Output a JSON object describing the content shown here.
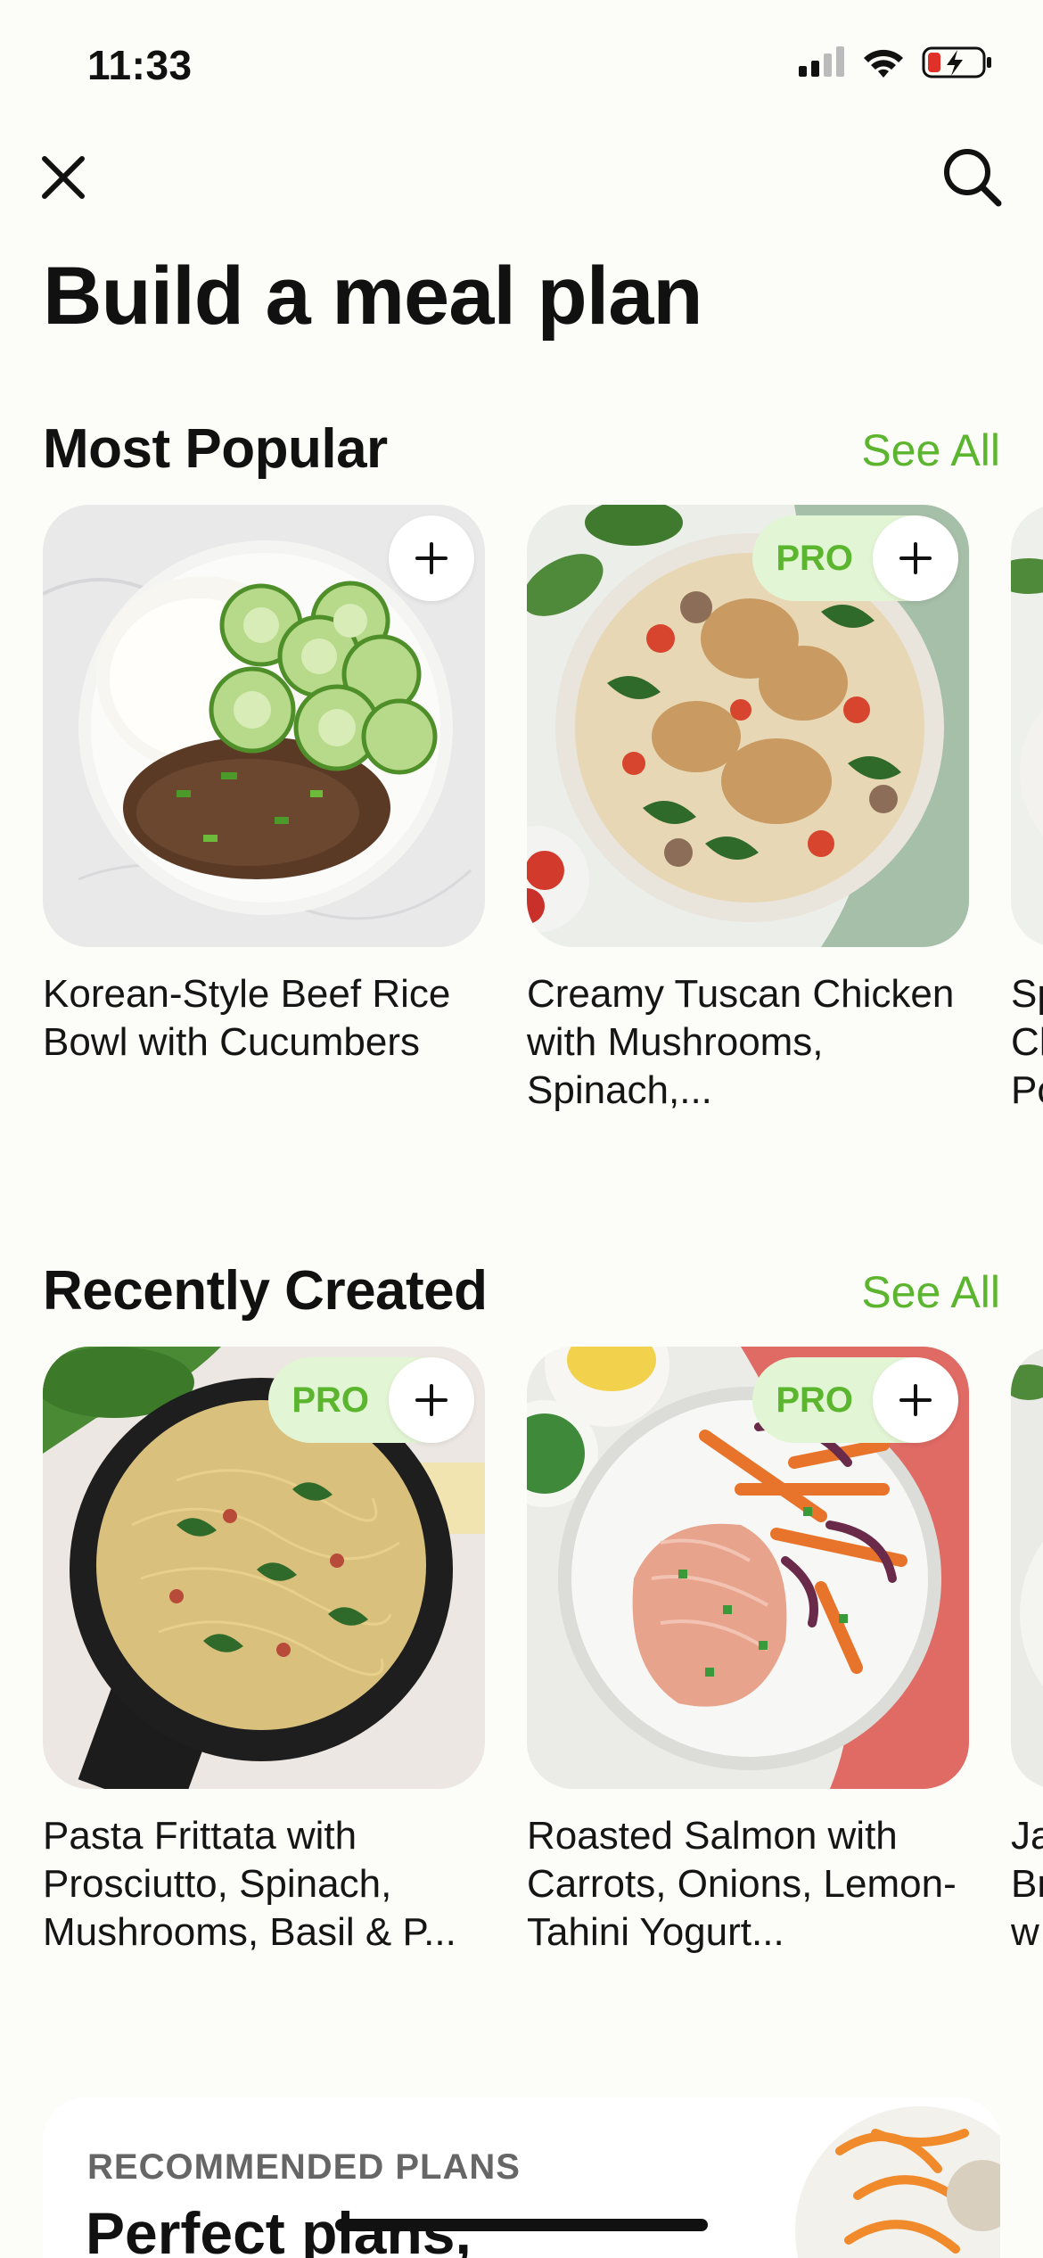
{
  "status": {
    "time": "11:33"
  },
  "nav": {
    "close_icon": "close-icon",
    "search_icon": "search-icon"
  },
  "page": {
    "title": "Build a meal plan"
  },
  "sections": [
    {
      "title": "Most Popular",
      "see_all": "See All",
      "cards": [
        {
          "title": "Korean-Style Beef Rice Bowl with Cucumbers",
          "pro": false
        },
        {
          "title": "Creamy Tuscan Chicken with Mushrooms, Spinach,...",
          "pro": true,
          "pro_label": "PRO"
        },
        {
          "title": "Sp Ch Po",
          "pro": false
        }
      ]
    },
    {
      "title": "Recently Created",
      "see_all": "See All",
      "cards": [
        {
          "title": "Pasta Frittata with Prosciutto, Spinach, Mushrooms, Basil & P...",
          "pro": true,
          "pro_label": "PRO"
        },
        {
          "title": "Roasted Salmon with Carrots, Onions, Lemon-Tahini Yogurt...",
          "pro": true,
          "pro_label": "PRO"
        },
        {
          "title": "Ja Br w",
          "pro": false
        }
      ]
    }
  ],
  "recommended": {
    "eyebrow": "RECOMMENDED PLANS",
    "heading": "Perfect plans,"
  },
  "colors": {
    "accent": "#5bb52f",
    "pro_bg": "#e2f5d4",
    "background": "#fcfcf8"
  }
}
